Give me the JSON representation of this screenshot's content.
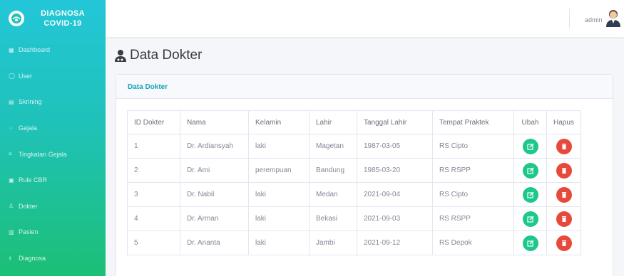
{
  "brand": {
    "line1": "DIAGNOSA",
    "line2": "COVID-19"
  },
  "sidebar": {
    "items": [
      {
        "label": "Dashboard",
        "icon": "dashboard-icon"
      },
      {
        "label": "User",
        "icon": "user-icon"
      },
      {
        "label": "Skrining",
        "icon": "table-icon"
      },
      {
        "label": "Gejala",
        "icon": "virus-icon"
      },
      {
        "label": "Tingkatan Gejala",
        "icon": "list-icon"
      },
      {
        "label": "Rule CBR",
        "icon": "rule-icon"
      },
      {
        "label": "Dokter",
        "icon": "doctor-icon"
      },
      {
        "label": "Pasien",
        "icon": "patient-icon"
      },
      {
        "label": "Diagnosa",
        "icon": "diagnosa-icon"
      }
    ]
  },
  "topbar": {
    "admin_name": "admin"
  },
  "page": {
    "title": "Data Dokter"
  },
  "card": {
    "title": "Data Dokter"
  },
  "table": {
    "headers": [
      "ID Dokter",
      "Nama",
      "Kelamin",
      "Lahir",
      "Tanggal Lahir",
      "Tempat Praktek",
      "Ubah",
      "Hapus"
    ],
    "rows": [
      [
        "1",
        "Dr. Ardiansyah",
        "laki",
        "Magetan",
        "1987-03-05",
        "RS Cipto"
      ],
      [
        "2",
        "Dr. Ami",
        "perempuan",
        "Bandung",
        "1985-03-20",
        "RS RSPP"
      ],
      [
        "3",
        "Dr. Nabil",
        "laki",
        "Medan",
        "2021-09-04",
        "RS Cipto"
      ],
      [
        "4",
        "Dr. Arman",
        "laki",
        "Bekasi",
        "2021-09-03",
        "RS RSPP"
      ],
      [
        "5",
        "Dr. Ananta",
        "laki",
        "Jambi",
        "2021-09-12",
        "RS Depok"
      ]
    ]
  },
  "colors": {
    "sidebar_top": "#23c6d8",
    "sidebar_bottom": "#1cbf75",
    "edit": "#1cc88a",
    "delete": "#e74a3b",
    "card_title": "#17a2b8"
  }
}
